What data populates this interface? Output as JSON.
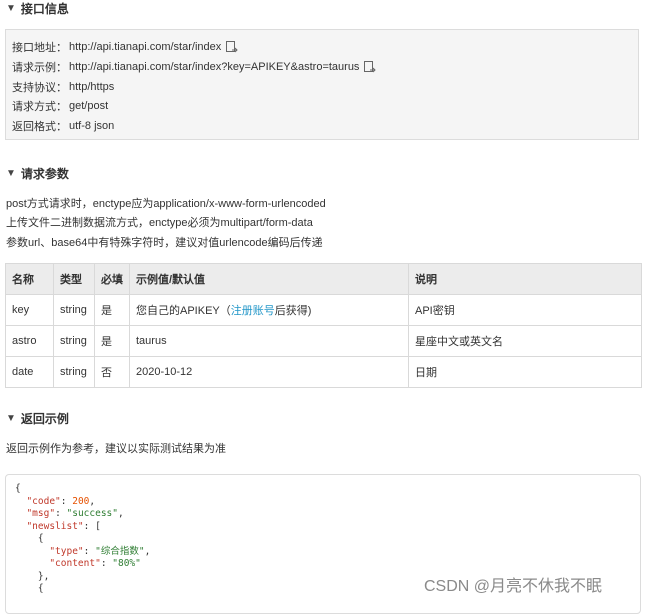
{
  "sections": {
    "interface": "接口信息",
    "params": "请求参数",
    "response": "返回示例"
  },
  "info": [
    {
      "label": "接口地址：",
      "value": "http://api.tianapi.com/star/index",
      "copy": true
    },
    {
      "label": "请求示例：",
      "value": "http://api.tianapi.com/star/index?key=APIKEY&astro=taurus",
      "copy": true
    },
    {
      "label": "支持协议：",
      "value": "http/https",
      "copy": false
    },
    {
      "label": "请求方式：",
      "value": "get/post",
      "copy": false
    },
    {
      "label": "返回格式：",
      "value": "utf-8 json",
      "copy": false
    }
  ],
  "param_notes": [
    "post方式请求时，enctype应为application/x-www-form-urlencoded",
    "上传文件二进制数据流方式，enctype必须为multipart/form-data",
    "参数url、base64中有特殊字符时，建议对值urlencode编码后传递"
  ],
  "table": {
    "headers": [
      "名称",
      "类型",
      "必填",
      "示例值/默认值",
      "说明"
    ],
    "rows": [
      {
        "name": "key",
        "type": "string",
        "required": "是",
        "example_pre": "您自己的APIKEY（",
        "example_link": "注册账号",
        "example_post": "后获得)",
        "desc": "API密钥"
      },
      {
        "name": "astro",
        "type": "string",
        "required": "是",
        "example": "taurus",
        "desc": "星座中文或英文名"
      },
      {
        "name": "date",
        "type": "string",
        "required": "否",
        "example": "2020-10-12",
        "desc": "日期"
      }
    ]
  },
  "response_note": "返回示例作为参考，建议以实际测试结果为准",
  "code": {
    "open": "{",
    "code_key": "\"code\"",
    "code_val": "200",
    "msg_key": "\"msg\"",
    "msg_val": "\"success\"",
    "newslist_key": "\"newslist\"",
    "type_key": "\"type\"",
    "type_val": "\"综合指数\"",
    "content_key": "\"content\"",
    "content_val": "\"80%\""
  },
  "watermark": "CSDN @月亮不休我不眠"
}
